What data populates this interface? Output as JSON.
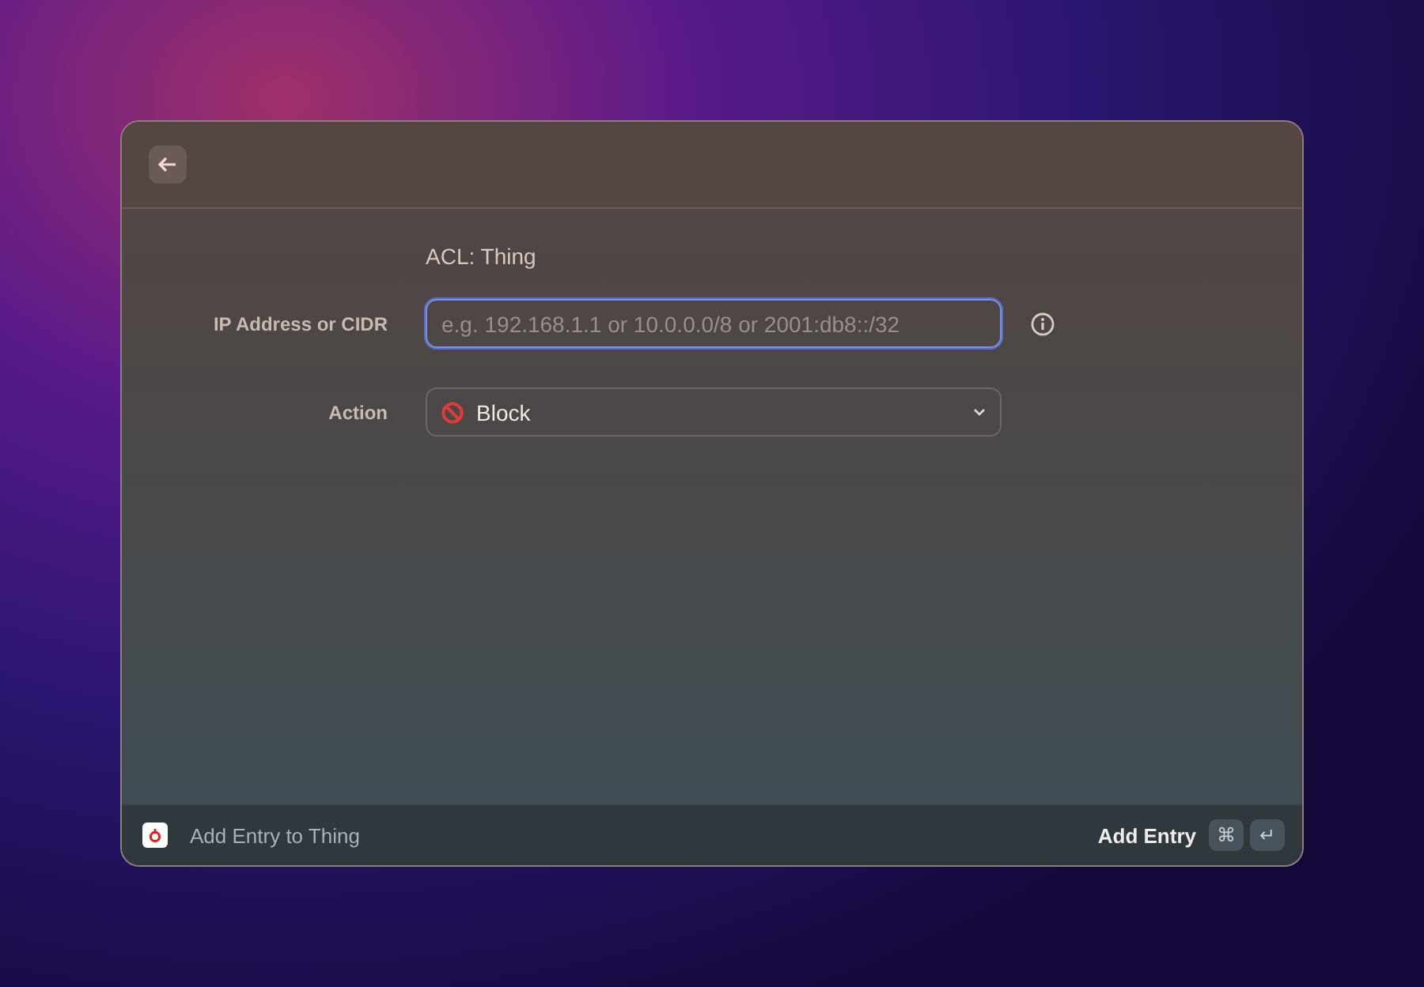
{
  "title": "ACL: Thing",
  "fields": [
    {
      "kind": "text",
      "label": "IP Address or CIDR",
      "placeholder": "e.g. 192.168.1.1 or 10.0.0.0/8 or 2001:db8::/32",
      "focused": true
    },
    {
      "kind": "select",
      "label": "Action",
      "value": "Block"
    }
  ],
  "footer": {
    "title": "Add Entry to Thing",
    "action": "Add Entry",
    "shortcut": [
      "⌘",
      "↵"
    ]
  }
}
